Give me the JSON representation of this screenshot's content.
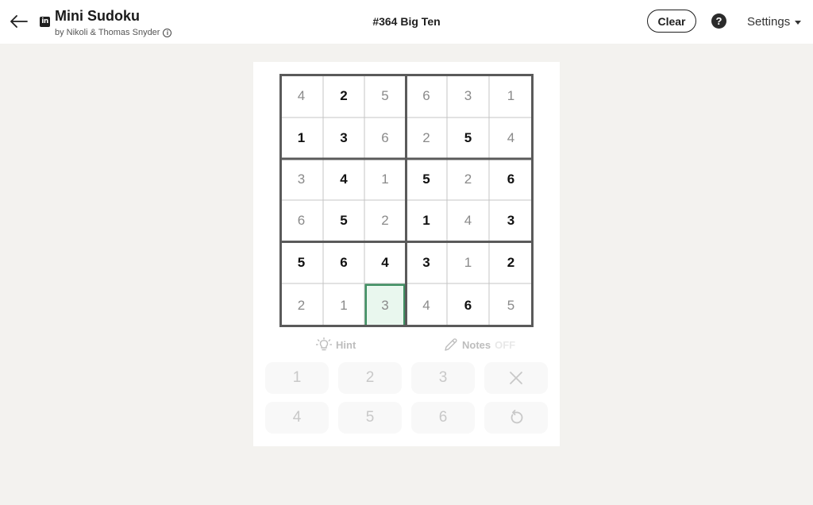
{
  "header": {
    "back_icon": "arrow-left-icon",
    "logo_text": "in",
    "title": "Mini Sudoku",
    "byline": "by Nikoli & Thomas Snyder",
    "info_icon": "info-icon",
    "puzzle_label": "#364 Big Ten",
    "clear_label": "Clear",
    "help_icon": "question-icon",
    "settings_label": "Settings"
  },
  "board": {
    "selected": [
      5,
      2
    ],
    "rows": [
      [
        {
          "v": "4",
          "given": false
        },
        {
          "v": "2",
          "given": true
        },
        {
          "v": "5",
          "given": false
        },
        {
          "v": "6",
          "given": false
        },
        {
          "v": "3",
          "given": false
        },
        {
          "v": "1",
          "given": false
        }
      ],
      [
        {
          "v": "1",
          "given": true
        },
        {
          "v": "3",
          "given": true
        },
        {
          "v": "6",
          "given": false
        },
        {
          "v": "2",
          "given": false
        },
        {
          "v": "5",
          "given": true
        },
        {
          "v": "4",
          "given": false
        }
      ],
      [
        {
          "v": "3",
          "given": false
        },
        {
          "v": "4",
          "given": true
        },
        {
          "v": "1",
          "given": false
        },
        {
          "v": "5",
          "given": true
        },
        {
          "v": "2",
          "given": false
        },
        {
          "v": "6",
          "given": true
        }
      ],
      [
        {
          "v": "6",
          "given": false
        },
        {
          "v": "5",
          "given": true
        },
        {
          "v": "2",
          "given": false
        },
        {
          "v": "1",
          "given": true
        },
        {
          "v": "4",
          "given": false
        },
        {
          "v": "3",
          "given": true
        }
      ],
      [
        {
          "v": "5",
          "given": true
        },
        {
          "v": "6",
          "given": true
        },
        {
          "v": "4",
          "given": true
        },
        {
          "v": "3",
          "given": true
        },
        {
          "v": "1",
          "given": false
        },
        {
          "v": "2",
          "given": true
        }
      ],
      [
        {
          "v": "2",
          "given": false
        },
        {
          "v": "1",
          "given": false
        },
        {
          "v": "3",
          "given": false
        },
        {
          "v": "4",
          "given": false
        },
        {
          "v": "6",
          "given": true
        },
        {
          "v": "5",
          "given": false
        }
      ]
    ]
  },
  "tools": {
    "hint_label": "Hint",
    "hint_icon": "lightbulb-icon",
    "notes_label": "Notes",
    "notes_state": "OFF",
    "notes_icon": "pencil-icon"
  },
  "keypad": {
    "numbers": [
      "1",
      "2",
      "3",
      "4",
      "5",
      "6"
    ],
    "erase_icon": "close-icon",
    "undo_icon": "undo-icon"
  },
  "colors": {
    "selected_border": "#3f8f62",
    "selected_fill": "#e9f7ee",
    "page_background": "#f3f2ef"
  }
}
